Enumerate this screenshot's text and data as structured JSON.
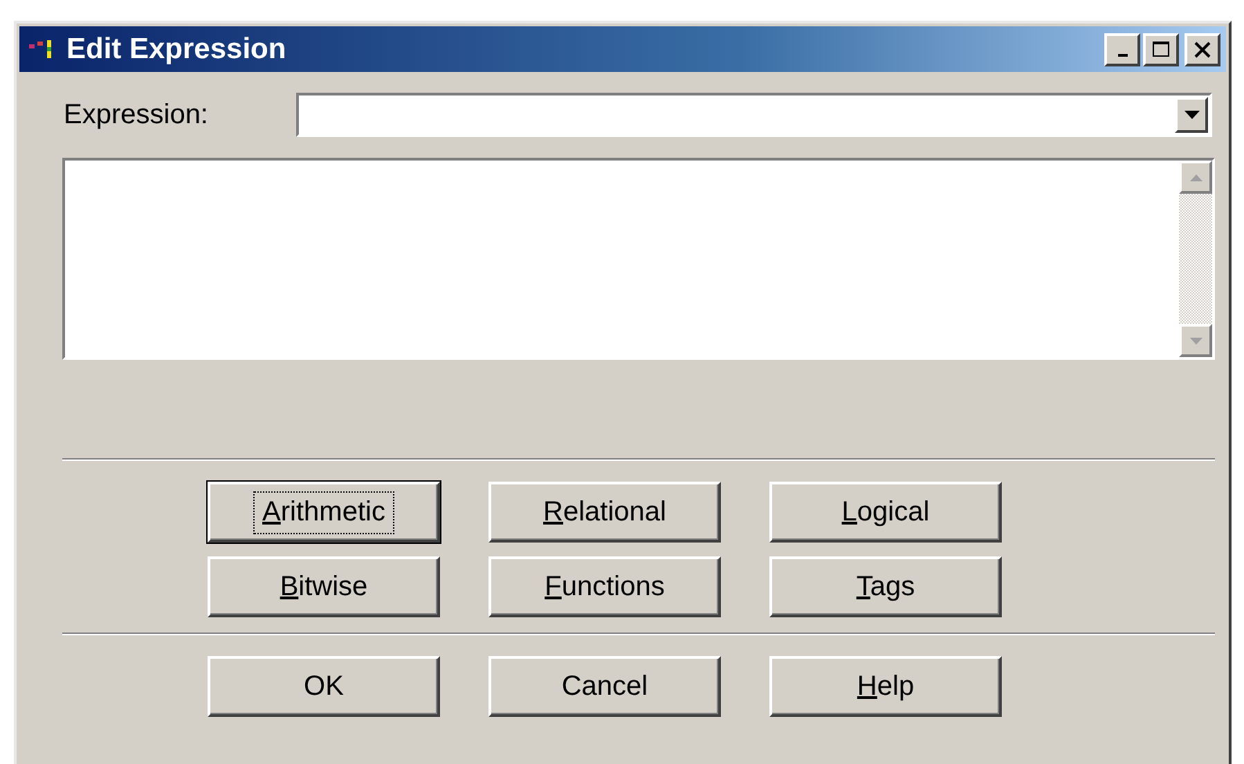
{
  "window": {
    "title": "Edit Expression"
  },
  "expression": {
    "label": "Expression:"
  },
  "operator_buttons": [
    {
      "key": "A",
      "rest": "rithmetic",
      "focused": true
    },
    {
      "key": "R",
      "rest": "elational",
      "focused": false
    },
    {
      "key": "L",
      "rest": "ogical",
      "focused": false
    },
    {
      "key": "B",
      "rest": "itwise",
      "focused": false
    },
    {
      "key": "F",
      "rest": "unctions",
      "focused": false
    },
    {
      "key": "T",
      "rest": "ags",
      "focused": false
    }
  ],
  "dialog_buttons": [
    {
      "rest": "OK",
      "focused": false
    },
    {
      "rest": "Cancel",
      "focused": false
    },
    {
      "key": "H",
      "rest": "elp",
      "focused": false
    }
  ]
}
